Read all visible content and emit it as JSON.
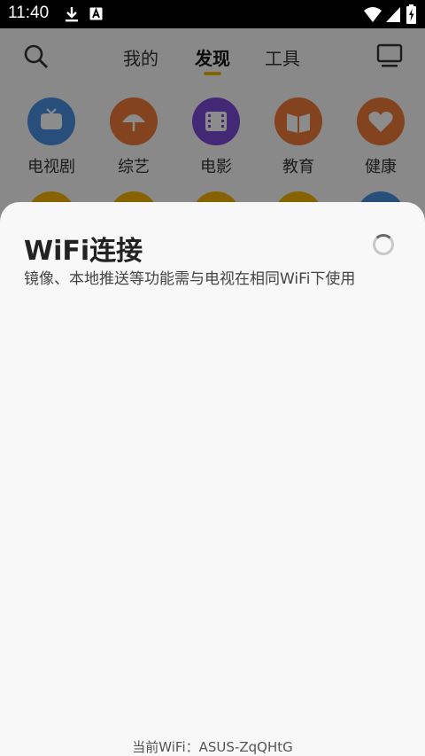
{
  "status_bar": {
    "time": "11:40",
    "icons": [
      "download-icon",
      "a-notification-icon",
      "wifi-icon",
      "signal-icon",
      "battery-charging-icon"
    ]
  },
  "nav": {
    "tabs": [
      {
        "label": "我的",
        "active": false
      },
      {
        "label": "发现",
        "active": true
      },
      {
        "label": "工具",
        "active": false
      }
    ],
    "accent_color": "#f5b400"
  },
  "categories": [
    {
      "label": "电视剧",
      "icon": "tv-icon",
      "color": "#4a90e2"
    },
    {
      "label": "综艺",
      "icon": "umbrella-icon",
      "color": "#f07a3a"
    },
    {
      "label": "电影",
      "icon": "film-icon",
      "color": "#7b4bd6"
    },
    {
      "label": "教育",
      "icon": "book-icon",
      "color": "#f07a3a"
    },
    {
      "label": "健康",
      "icon": "heart-icon",
      "color": "#f07a3a"
    }
  ],
  "sheet": {
    "title": "WiFi连接",
    "description": "镜像、本地推送等功能需与电视在相同WiFi下使用",
    "current_wifi": "当前WiFi：ASUS-ZqQHtG"
  }
}
